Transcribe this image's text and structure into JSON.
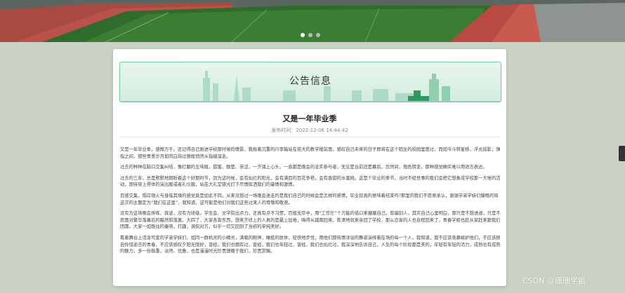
{
  "banner": {
    "slides": 3,
    "active_slide": 1
  },
  "notice": {
    "header_title": "公告信息",
    "article_title": "又是一年毕业季",
    "publish_time": "发布时间：2022-12-06 14:44:42",
    "paragraphs": [
      "又是一年毕业季，感慨万千。还记得自己刚进学校那时候的情景，我拖着沉重的行李箱站在偌大的教学楼前面，感叹自己未来的日子即将在这个陌生的校园里度过，而如今斗转星移，浮光掠影，弹指之间，那些青葱岁月如同白驹过隙般悄然从指缝溜走。",
      "过去的种种在脑口交集纠结，像打翻的五味瓶，甜蜜、酸楚、苦涩，一齐涌上心头。一直都是晚会的忠实参与者，无论是台前还是幕后，忽然间，角色转变，那种感觉确实难以用语言表达。",
      "过去的三年，总是默默地期盼着这个好期时节，因为这时候，会有灿烂的阳光，会有满目的百花争艳，会有香甜的水蜜桃，这是个毕业的季节，当时不经世事的我们会把它想象成学校那一大堆的活动，期待穿上得体的演出服或者礼仪服，站在大礼堂镁光灯下尽情挥洒我们的豪情和激情。",
      "百感交集，隔岸观火与身临其境的感觉竟是如此不同。从来没想过一场晚会送走的是我们自己的时候会是怎样的感情，毕业就真的意味着结束吗?那里的我们不愿意承认，谢谢学弟学妹们慷慨的将这次的主题定为“我们在这里”，我知道，这可能是他们对我们这些过来人的尊敬和敬意。",
      "没有为这场晚会排练、奔波，没有为班级、学生会、文学院出点力，还真有点不习惯，百般无奈中，用“工作忙”个万能的借口来搪塞自己，欺骗别人。其实自己心里明白，那只是不想进退，只是不愿面对繁华落幕后的黯然和落寞。大四了，大家各奔东西，想来齐班上的人真的是最上加难，晦得从越南回来，陈清地就来亲回了学校，那么恋家的人也自程回来了，青春学姐也赶从家赶来跟我们团圆。大家一如既往的秦晓，打趣，调侃对方，似乎一切又回到了当初的单纯美好。",
      "看着舞台上活泼可爱的学弟学妹们，如同一群机灵的小精灵，满载的眼神，橄榄的肤体，轻快地步伐，用他们那热情洋溢的舞姿演绎着在场的每一个人，我知道，我不应该羡慕嫉妒他们，不应该顾自怜惜逝去的青春，不应该感叹夕阳无限好，曾经，我们也拥有过，曾经，我们也年轻过，曾经，我们也灿烂过，我深深地告诉自己，人生的每个阶段都是美的，年轻有年轻的活力，成熟也有成熟的魅力，多一份稳重，淡然、优雅，也是漫漫时光珍贵馈赠于我们，珍贵赏赐。"
    ]
  },
  "watermark": "CSDN @珊珊学姐"
}
